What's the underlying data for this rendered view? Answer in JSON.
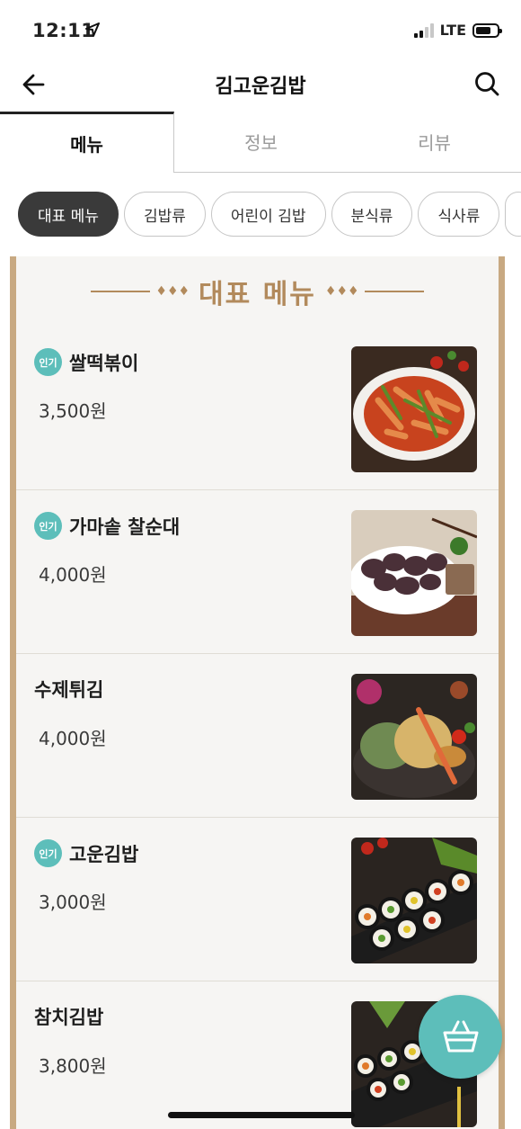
{
  "status_bar": {
    "time": "12:11",
    "network": "LTE"
  },
  "header": {
    "title": "김고운김밥"
  },
  "tabs": [
    {
      "label": "메뉴",
      "active": true
    },
    {
      "label": "정보",
      "active": false
    },
    {
      "label": "리뷰",
      "active": false
    }
  ],
  "categories": [
    "대표 메뉴",
    "김밥류",
    "어린이 김밥",
    "분식류",
    "식사류"
  ],
  "section": {
    "title": "대표 메뉴"
  },
  "menu_items": [
    {
      "name": "쌀떡볶이",
      "price": "3,500원",
      "popular": true,
      "badge": "인기",
      "photo_icon": "tteokbokki-photo"
    },
    {
      "name": "가마솥 찰순대",
      "price": "4,000원",
      "popular": true,
      "badge": "인기",
      "photo_icon": "sundae-photo"
    },
    {
      "name": "수제튀김",
      "price": "4,000원",
      "popular": false,
      "badge": "",
      "photo_icon": "twigim-photo"
    },
    {
      "name": "고운김밥",
      "price": "3,000원",
      "popular": true,
      "badge": "인기",
      "photo_icon": "gimbap-photo"
    },
    {
      "name": "참치김밥",
      "price": "3,800원",
      "popular": false,
      "badge": "",
      "photo_icon": "tuna-gimbap-photo"
    }
  ],
  "colors": {
    "accent": "#5dbeba",
    "frame": "#c8a982",
    "section_title": "#b28a5c",
    "chip_active": "#3a3a3a"
  }
}
